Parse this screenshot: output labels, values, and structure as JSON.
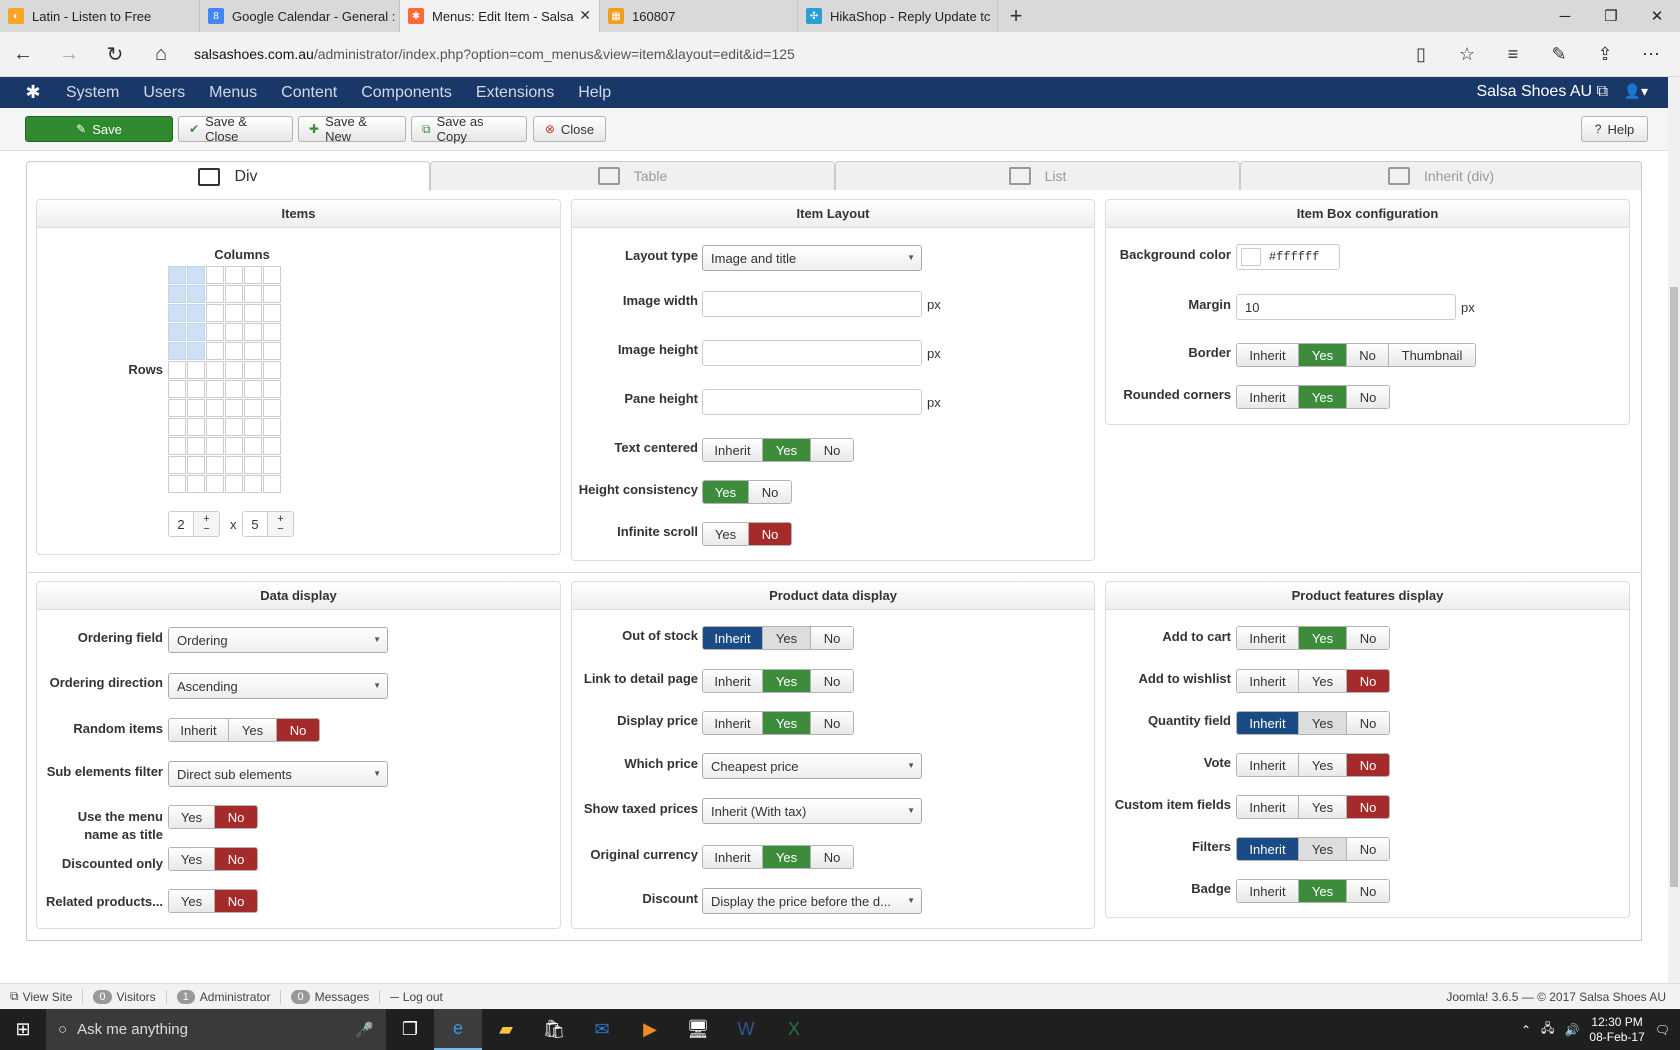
{
  "browser": {
    "tabs": [
      {
        "title": "Latin - Listen to Free",
        "color": "#f5a623"
      },
      {
        "title": "Google Calendar - General :",
        "color": "#4285f4"
      },
      {
        "title": "Menus: Edit Item - Salsa",
        "color": "#ff6b35"
      },
      {
        "title": "160807",
        "color": "#f0a020"
      },
      {
        "title": "HikaShop - Reply Update tc",
        "color": "#2a9fd6"
      }
    ],
    "url_host": "salsashoes.com.au",
    "url_path": "/administrator/index.php?option=com_menus&view=item&layout=edit&id=125"
  },
  "joomla": {
    "menu": [
      "System",
      "Users",
      "Menus",
      "Content",
      "Components",
      "Extensions",
      "Help"
    ],
    "site_name": "Salsa Shoes AU"
  },
  "toolbar": {
    "save": "Save",
    "save_close": "Save & Close",
    "save_new": "Save & New",
    "save_copy": "Save as Copy",
    "close": "Close",
    "help": "Help"
  },
  "layout_tabs": [
    "Div",
    "Table",
    "List",
    "Inherit (div)"
  ],
  "items": {
    "title": "Items",
    "columns_label": "Columns",
    "rows_label": "Rows",
    "columns_value": "2",
    "x": "x",
    "rows_value": "5"
  },
  "item_layout": {
    "title": "Item Layout",
    "layout_type_label": "Layout type",
    "layout_type_value": "Image and title",
    "image_width_label": "Image width",
    "image_height_label": "Image height",
    "pane_height_label": "Pane height",
    "px": "px",
    "text_centered_label": "Text centered",
    "height_consistency_label": "Height consistency",
    "infinite_scroll_label": "Infinite scroll"
  },
  "item_box": {
    "title": "Item Box configuration",
    "background_label": "Background color",
    "background_value": "#ffffff",
    "margin_label": "Margin",
    "margin_value": "10",
    "border_label": "Border",
    "rounded_label": "Rounded corners"
  },
  "data_display": {
    "title": "Data display",
    "ordering_field_label": "Ordering field",
    "ordering_field_value": "Ordering",
    "ordering_direction_label": "Ordering direction",
    "ordering_direction_value": "Ascending",
    "random_items_label": "Random items",
    "sub_elements_label": "Sub elements filter",
    "sub_elements_value": "Direct sub elements",
    "use_menu_label_1": "Use the menu",
    "use_menu_label_2": "name as title",
    "discounted_label": "Discounted only",
    "related_label": "Related products..."
  },
  "product_data": {
    "title": "Product data display",
    "out_of_stock_label": "Out of stock",
    "link_detail_label": "Link to detail page",
    "display_price_label": "Display price",
    "which_price_label": "Which price",
    "which_price_value": "Cheapest price",
    "show_taxed_label": "Show taxed prices",
    "show_taxed_value": "Inherit (With tax)",
    "original_currency_label": "Original currency",
    "discount_label": "Discount",
    "discount_value": "Display the price before the d..."
  },
  "features": {
    "title": "Product features display",
    "add_cart_label": "Add to cart",
    "add_wishlist_label": "Add to wishlist",
    "quantity_label": "Quantity field",
    "vote_label": "Vote",
    "custom_fields_label": "Custom item fields",
    "filters_label": "Filters",
    "badge_label": "Badge"
  },
  "opts": {
    "inherit": "Inherit",
    "yes": "Yes",
    "no": "No",
    "thumbnail": "Thumbnail"
  },
  "status": {
    "view_site": "View Site",
    "visitors_count": "0",
    "visitors": "Visitors",
    "admin_count": "1",
    "admin": "Administrator",
    "messages_count": "0",
    "messages": "Messages",
    "logout": "Log out",
    "version": "Joomla! 3.6.5 — © 2017 Salsa Shoes AU"
  },
  "taskbar": {
    "search": "Ask me anything",
    "time": "12:30 PM",
    "date": "08-Feb-17"
  }
}
